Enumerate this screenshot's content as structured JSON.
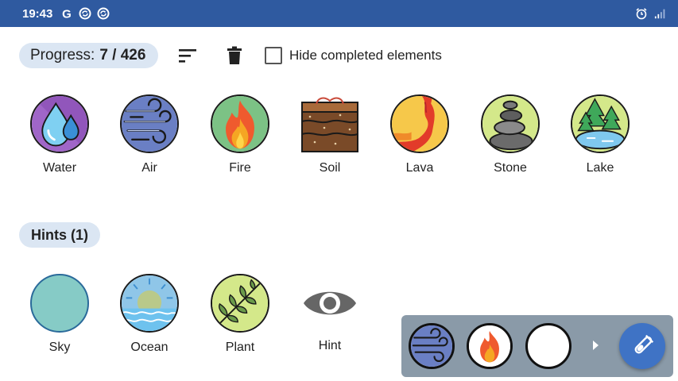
{
  "status_bar": {
    "time": "19:43",
    "left_icons": [
      "google-icon",
      "sync-icon",
      "sync-icon"
    ],
    "right_icons": [
      "alarm-icon",
      "signal-icon"
    ]
  },
  "toolbar": {
    "progress_label": "Progress:",
    "progress_value": "7 / 426",
    "sort_icon": "sort-icon",
    "delete_icon": "trash-icon",
    "hide_completed_label": "Hide completed elements",
    "hide_completed_checked": false
  },
  "elements": [
    {
      "name": "Water",
      "icon": "water-icon"
    },
    {
      "name": "Air",
      "icon": "air-icon"
    },
    {
      "name": "Fire",
      "icon": "fire-icon"
    },
    {
      "name": "Soil",
      "icon": "soil-icon"
    },
    {
      "name": "Lava",
      "icon": "lava-icon"
    },
    {
      "name": "Stone",
      "icon": "stone-icon"
    },
    {
      "name": "Lake",
      "icon": "lake-icon"
    }
  ],
  "hints": {
    "title": "Hints (1)",
    "items": [
      {
        "name": "Sky",
        "icon": "sky-icon"
      },
      {
        "name": "Ocean",
        "icon": "ocean-icon"
      },
      {
        "name": "Plant",
        "icon": "plant-icon"
      },
      {
        "name": "Hint",
        "icon": "eye-icon"
      }
    ]
  },
  "mixer": {
    "slots": [
      "air-icon",
      "fire-icon",
      "empty"
    ],
    "arrow_icon": "play-arrow-icon",
    "action_icon": "test-tube-icon"
  },
  "colors": {
    "status_bar": "#2f5aa0",
    "pill": "#dbe6f3",
    "tray": "#8a9aa8",
    "fab": "#3f73c5"
  }
}
